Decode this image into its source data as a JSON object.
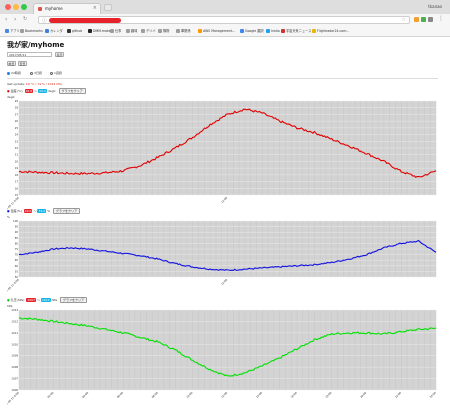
{
  "window": {
    "tab_title": "myhome",
    "user": "tkanao"
  },
  "bookmarks": [
    {
      "label": "アプリ",
      "color": "#4a86e8"
    },
    {
      "label": "Bookmarks",
      "color": "#9e9e9e"
    },
    {
      "label": "カレンダ",
      "color": "#3f7fe0"
    },
    {
      "label": "github",
      "color": "#333333"
    },
    {
      "label": "DMM.make",
      "color": "#222222"
    },
    {
      "label": "仕事",
      "color": "#9e9e9e"
    },
    {
      "label": "趣味",
      "color": "#9e9e9e"
    },
    {
      "label": "デリバ",
      "color": "#9e9e9e"
    },
    {
      "label": "購物",
      "color": "#9e9e9e"
    },
    {
      "label": "車関係",
      "color": "#9e9e9e"
    },
    {
      "label": "AWS Management...",
      "color": "#ff9900"
    },
    {
      "label": "Google 翻訳",
      "color": "#4285f4"
    },
    {
      "label": "Instio",
      "color": "#1da1f2"
    },
    {
      "label": "宇宙天気ニュース",
      "color": "#cc3333"
    },
    {
      "label": "Flightradar24.com...",
      "color": "#e6b800"
    }
  ],
  "page": {
    "title": "我が家/myhome",
    "date_value": "2017/05/11",
    "show_button": "表示",
    "prev_button": "前日",
    "next_button": "翌日",
    "radios": [
      {
        "label": "24時間",
        "checked": true
      },
      {
        "label": "3日間",
        "checked": false
      },
      {
        "label": "1週間",
        "checked": false
      }
    ],
    "status_prefix": "last update:",
    "status_value": "18 °C / 74 % / 1012 hPa",
    "charts": [
      {
        "legend_label": "温度",
        "legend_suffix": "(°C)",
        "pill1": "18.8",
        "pill1_color": "#e8222b",
        "between": "〜",
        "pill2": "23.2",
        "pill2_color": "#17b5e6",
        "unit_text": "degC",
        "button": "グラフをクリア",
        "dot_color": "#e00000",
        "axis_unit": "degC",
        "y_ticks": [
          "29",
          "28",
          "27",
          "26",
          "25",
          "24",
          "23",
          "22",
          "21",
          "20",
          "19",
          "18",
          "17",
          "16",
          "15"
        ]
      },
      {
        "legend_label": "湿度",
        "legend_suffix": "(%)",
        "pill1": "60.0",
        "pill1_color": "#e8222b",
        "between": "〜",
        "pill2": "74.0",
        "pill2_color": "#17b5e6",
        "unit_text": "%",
        "button": "グラフをクリア",
        "dot_color": "#1010e0",
        "axis_unit": "%",
        "y_ticks": [
          "100",
          "95",
          "90",
          "85",
          "80",
          "75",
          "70",
          "65",
          "60",
          "55",
          "50"
        ]
      },
      {
        "legend_label": "気圧",
        "legend_suffix": "(hPa)",
        "pill1": "1007",
        "pill1_color": "#e8222b",
        "between": "〜",
        "pill2": "1012",
        "pill2_color": "#17b5e6",
        "unit_text": "hPa",
        "button": "グラフをクリア",
        "dot_color": "#00e000",
        "axis_unit": "hPa",
        "y_ticks": [
          "1013",
          "1012",
          "1011",
          "1010",
          "1009",
          "1008",
          "1007",
          "1006"
        ]
      }
    ]
  },
  "chart_data": [
    {
      "type": "line",
      "title": "",
      "ylabel": "degC",
      "ylim": [
        15,
        29
      ],
      "x": [
        "00:00",
        "01:00",
        "02:00",
        "03:00",
        "04:00",
        "05:00",
        "06:00",
        "07:00",
        "08:00",
        "09:00",
        "10:00",
        "11:00",
        "12:00",
        "13:00",
        "14:00",
        "15:00",
        "16:00",
        "17:00",
        "18:00",
        "19:00",
        "20:00",
        "21:00",
        "22:00",
        "23:00",
        "24:00"
      ],
      "x_tick_labels": [
        "2017-05-11 0:00",
        "12:00"
      ],
      "series": [
        {
          "color": "#e00000",
          "values": [
            18.5,
            18.4,
            18.3,
            18.2,
            18.2,
            18.3,
            18.6,
            19.4,
            20.6,
            22.0,
            23.6,
            25.5,
            27.0,
            27.8,
            27.2,
            26.0,
            25.0,
            24.3,
            23.3,
            22.3,
            21.2,
            20.0,
            18.5,
            17.6,
            18.6
          ]
        }
      ],
      "grid": true
    },
    {
      "type": "line",
      "title": "",
      "ylabel": "%",
      "ylim": [
        50,
        100
      ],
      "x": [
        "00:00",
        "01:00",
        "02:00",
        "03:00",
        "04:00",
        "05:00",
        "06:00",
        "07:00",
        "08:00",
        "09:00",
        "10:00",
        "11:00",
        "12:00",
        "13:00",
        "14:00",
        "15:00",
        "16:00",
        "17:00",
        "18:00",
        "19:00",
        "20:00",
        "21:00",
        "22:00",
        "23:00",
        "24:00"
      ],
      "x_tick_labels": [
        "2017-05-11 0:00",
        "12:00"
      ],
      "series": [
        {
          "color": "#1010e0",
          "values": [
            70,
            72,
            75,
            76,
            75,
            73,
            71,
            69,
            66,
            62,
            59,
            57,
            56,
            57,
            58,
            59,
            60,
            61,
            63,
            66,
            70,
            76,
            80,
            82,
            72
          ]
        }
      ],
      "grid": true
    },
    {
      "type": "line",
      "title": "",
      "ylabel": "hPa",
      "ylim": [
        1006,
        1013
      ],
      "x": [
        "00:00",
        "01:00",
        "02:00",
        "03:00",
        "04:00",
        "05:00",
        "06:00",
        "07:00",
        "08:00",
        "09:00",
        "10:00",
        "11:00",
        "12:00",
        "13:00",
        "14:00",
        "15:00",
        "16:00",
        "17:00",
        "18:00",
        "19:00",
        "20:00",
        "21:00",
        "22:00",
        "23:00",
        "24:00"
      ],
      "x_tick_labels": [
        "2017-05-11 0:00",
        "02:00",
        "04:00",
        "06:00",
        "08:00",
        "10:00",
        "12:00",
        "14:00",
        "16:00",
        "18:00",
        "20:00",
        "22:00",
        "24:00"
      ],
      "series": [
        {
          "color": "#00e000",
          "values": [
            1012.3,
            1012.2,
            1012.0,
            1011.8,
            1011.6,
            1011.3,
            1011.0,
            1010.6,
            1010.2,
            1009.5,
            1008.6,
            1007.8,
            1007.2,
            1007.5,
            1008.1,
            1008.8,
            1009.6,
            1010.4,
            1010.9,
            1011.0,
            1011.0,
            1010.9,
            1011.1,
            1011.3,
            1011.4
          ]
        }
      ],
      "grid": true
    }
  ]
}
